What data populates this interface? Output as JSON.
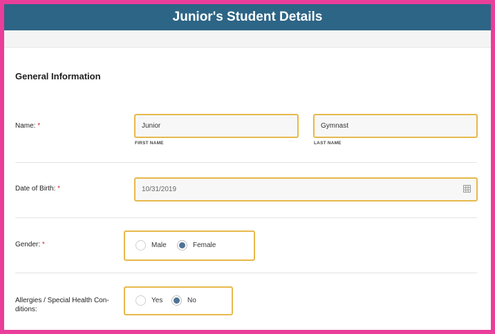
{
  "header": {
    "title": "Junior's Student Details"
  },
  "section": {
    "title": "General Information"
  },
  "name_field": {
    "label": "Name:",
    "required": "*",
    "first_name": {
      "value": "Junior",
      "caption": "FIRST NAME"
    },
    "last_name": {
      "value": "Gymnast",
      "caption": "LAST NAME"
    }
  },
  "dob_field": {
    "label": "Date of Birth:",
    "required": "*",
    "value": "10/31/2019",
    "icon": "calendar-icon"
  },
  "gender_field": {
    "label": "Gender:",
    "required": "*",
    "options": [
      {
        "label": "Male",
        "selected": false
      },
      {
        "label": "Female",
        "selected": true
      }
    ]
  },
  "allergies_field": {
    "label_line1": "Allergies / Special Health Con-",
    "label_line2": "ditions:",
    "options": [
      {
        "label": "Yes",
        "selected": false
      },
      {
        "label": "No",
        "selected": true
      }
    ]
  },
  "colors": {
    "header_bg": "#2d6586",
    "frame": "#e93e9a",
    "field_border": "#e7b84a",
    "radio_selected": "#4f7396",
    "required": "#d3272e"
  }
}
